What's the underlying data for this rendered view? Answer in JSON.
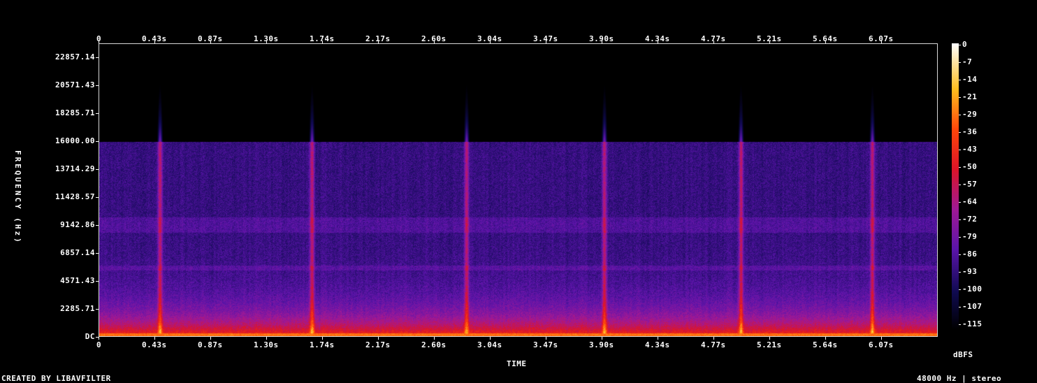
{
  "chart_data": {
    "type": "heatmap",
    "title": "",
    "xlabel": "TIME",
    "ylabel": "FREQUENCY (Hz)",
    "x_ticks": [
      "0",
      "0.43s",
      "0.87s",
      "1.30s",
      "1.74s",
      "2.17s",
      "2.60s",
      "3.04s",
      "3.47s",
      "3.90s",
      "4.34s",
      "4.77s",
      "5.21s",
      "5.64s",
      "6.07s"
    ],
    "y_ticks": [
      "22857.14",
      "20571.43",
      "18285.71",
      "16000.00",
      "13714.29",
      "11428.57",
      "9142.86",
      "6857.14",
      "4571.43",
      "2285.71",
      "DC"
    ],
    "xlim": [
      0,
      6.5
    ],
    "ylim": [
      0,
      24000
    ],
    "colorbar": {
      "label": "dBFS",
      "ticks": [
        "0",
        "-7",
        "-14",
        "-21",
        "-29",
        "-36",
        "-43",
        "-50",
        "-57",
        "-64",
        "-72",
        "-79",
        "-86",
        "-93",
        "-100",
        "-107",
        "-115"
      ],
      "range": [
        -120,
        0
      ]
    },
    "lowpass_cutoff_hz": 16000,
    "transient_times_s": [
      0.47,
      1.65,
      2.85,
      3.92,
      4.98,
      6.0
    ],
    "noise_floor_dbfs": -95,
    "bass_energy_dbfs": -40
  },
  "footer": {
    "left": "CREATED BY LIBAVFILTER",
    "right": "48000 Hz | stereo"
  }
}
